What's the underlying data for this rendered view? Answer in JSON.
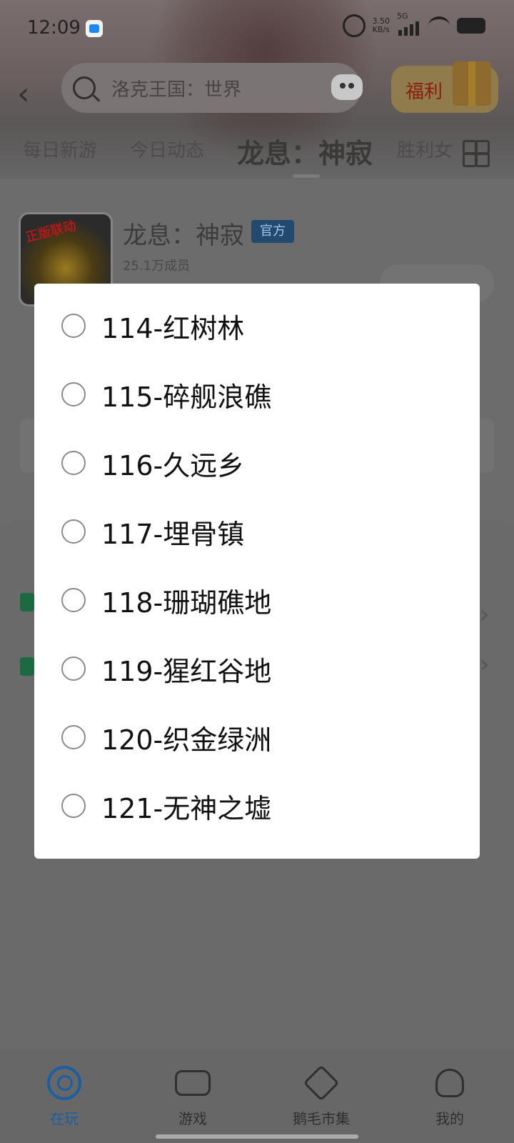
{
  "status_bar": {
    "time": "12:09",
    "network_speed_value": "3.50",
    "network_speed_unit": "KB/s",
    "network_type": "5G"
  },
  "header": {
    "search_text": "洛克王国：世界",
    "welfare_label": "福利"
  },
  "tabs": [
    {
      "label": "每日新游"
    },
    {
      "label": "今日动态"
    },
    {
      "label": "龙息：神寂"
    },
    {
      "label": "胜利女"
    }
  ],
  "game": {
    "name": "龙息：神寂",
    "badge": "官方",
    "members": "25.1万成员",
    "avatar_tag": "正版联动"
  },
  "modal": {
    "options": [
      {
        "label": "114-红树林",
        "selected": false
      },
      {
        "label": "115-碎舰浪礁",
        "selected": false
      },
      {
        "label": "116-久远乡",
        "selected": false
      },
      {
        "label": "117-埋骨镇",
        "selected": false
      },
      {
        "label": "118-珊瑚礁地",
        "selected": false
      },
      {
        "label": "119-猩红谷地",
        "selected": false
      },
      {
        "label": "120-织金绿洲",
        "selected": false
      },
      {
        "label": "121-无神之墟",
        "selected": false
      }
    ]
  },
  "bottom_nav": {
    "items": [
      {
        "label": "在玩",
        "icon": "play-icon",
        "active": true
      },
      {
        "label": "游戏",
        "icon": "gamepad-icon",
        "active": false
      },
      {
        "label": "鹅毛市集",
        "icon": "tag-icon",
        "active": false
      },
      {
        "label": "我的",
        "icon": "user-icon",
        "active": false
      }
    ]
  },
  "colors": {
    "accent": "#1a5ea4",
    "modal_bg": "#ffffff",
    "overlay_dim": "#6b6b6b"
  }
}
